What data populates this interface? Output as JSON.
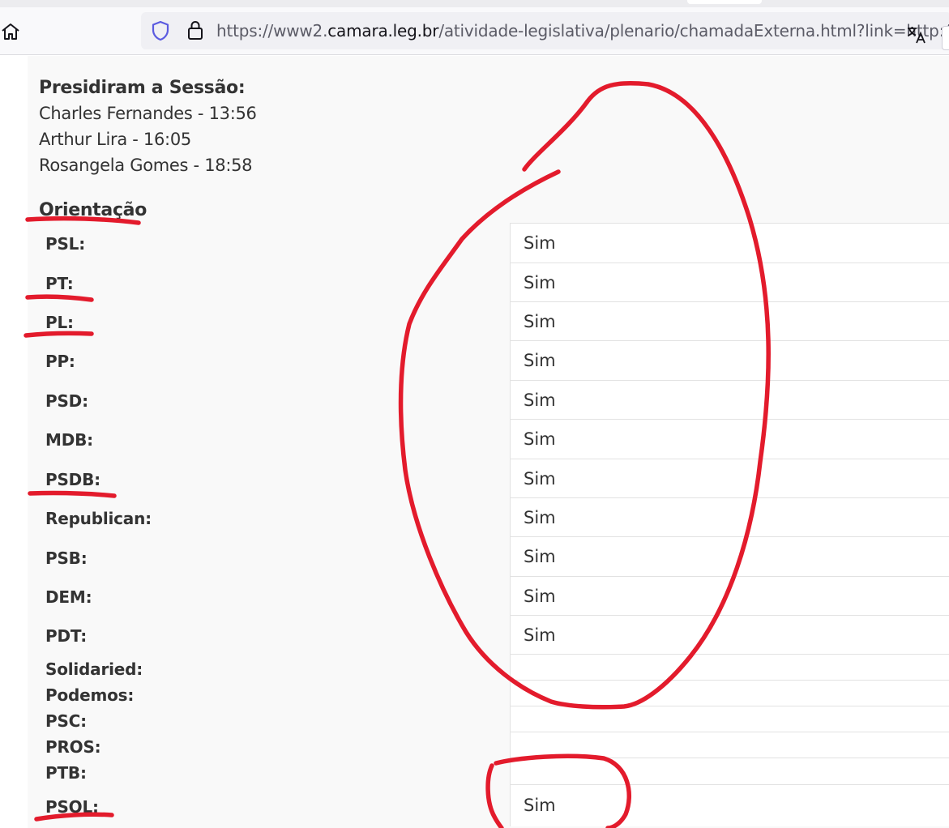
{
  "browser": {
    "url_prefix": "https://www2.",
    "url_domain": "camara.leg.br",
    "url_path": "/atividade-legislativa/plenario/chamadaExterna.html?link=http://"
  },
  "session": {
    "heading": "Presidiram a Sessão:",
    "presidents": [
      "Charles Fernandes - 13:56",
      "Arthur Lira - 16:05",
      "Rosangela Gomes - 18:58"
    ]
  },
  "orientation": {
    "heading": "Orientação",
    "rows": [
      {
        "party": "PSL:",
        "vote": "Sim"
      },
      {
        "party": "PT:",
        "vote": "Sim"
      },
      {
        "party": "PL:",
        "vote": "Sim"
      },
      {
        "party": "PP:",
        "vote": "Sim"
      },
      {
        "party": "PSD:",
        "vote": "Sim"
      },
      {
        "party": "MDB:",
        "vote": "Sim"
      },
      {
        "party": "PSDB:",
        "vote": "Sim"
      },
      {
        "party": "Republican:",
        "vote": "Sim"
      },
      {
        "party": "PSB:",
        "vote": "Sim"
      },
      {
        "party": "DEM:",
        "vote": "Sim"
      },
      {
        "party": "PDT:",
        "vote": "Sim"
      },
      {
        "party": "Solidaried:",
        "vote": ""
      },
      {
        "party": "Podemos:",
        "vote": ""
      },
      {
        "party": "PSC:",
        "vote": ""
      },
      {
        "party": "PROS:",
        "vote": ""
      },
      {
        "party": "PTB:",
        "vote": ""
      },
      {
        "party": "PSOL:",
        "vote": "Sim"
      }
    ]
  },
  "colors": {
    "annotation": "#e31b2c",
    "text": "#333333",
    "page_bg": "#f9f9f9"
  }
}
